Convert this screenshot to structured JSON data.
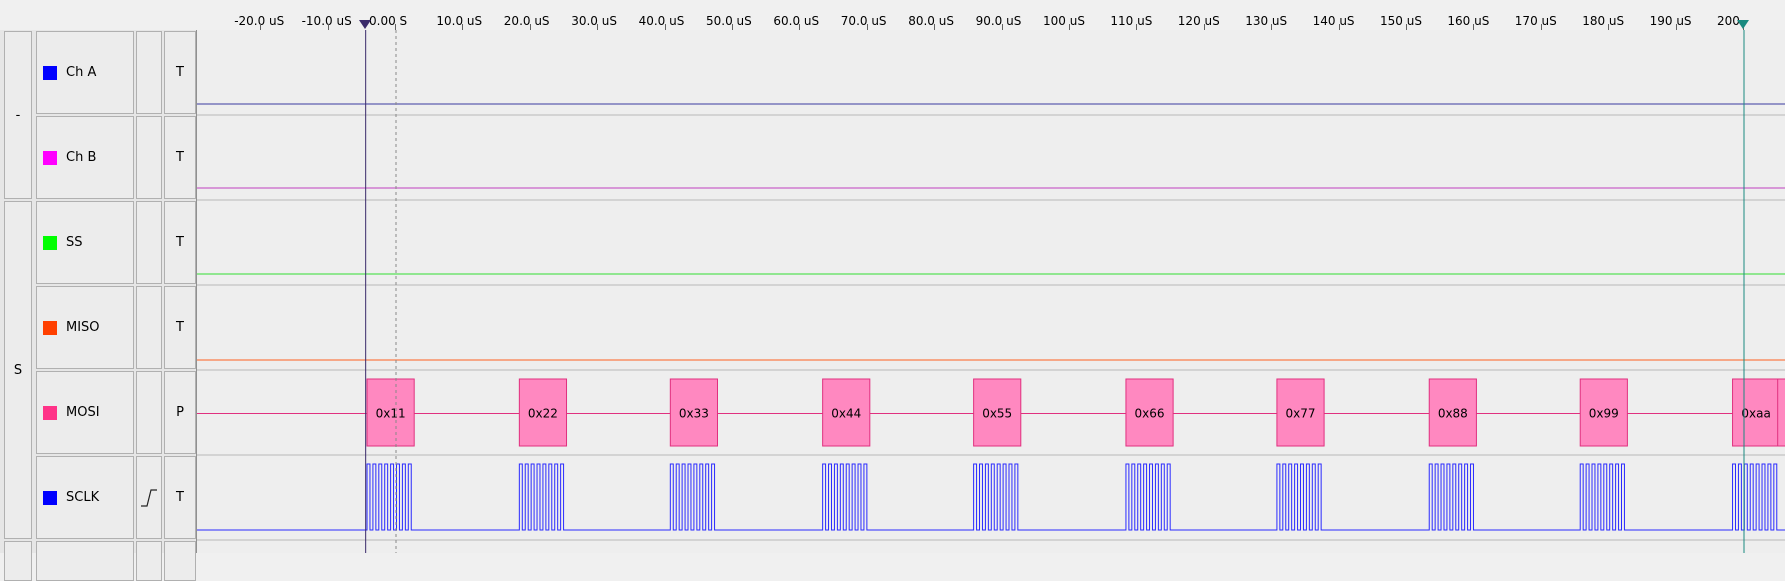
{
  "ruler": {
    "ticks": [
      {
        "label": "-20.0 uS",
        "t": -20
      },
      {
        "label": "-10.0 uS",
        "t": -10
      },
      {
        "label": "0.00  S",
        "t": 0
      },
      {
        "label": "10.0 uS",
        "t": 10
      },
      {
        "label": "20.0 uS",
        "t": 20
      },
      {
        "label": "30.0 uS",
        "t": 30
      },
      {
        "label": "40.0 uS",
        "t": 40
      },
      {
        "label": "50.0 uS",
        "t": 50
      },
      {
        "label": "60.0 uS",
        "t": 60
      },
      {
        "label": "70.0 uS",
        "t": 70
      },
      {
        "label": "80.0 uS",
        "t": 80
      },
      {
        "label": "90.0 uS",
        "t": 90
      },
      {
        "label": "100 uS",
        "t": 100
      },
      {
        "label": "110 uS",
        "t": 110
      },
      {
        "label": "120 uS",
        "t": 120
      },
      {
        "label": "130 uS",
        "t": 130
      },
      {
        "label": "140 uS",
        "t": 140
      },
      {
        "label": "150 uS",
        "t": 150
      },
      {
        "label": "160 uS",
        "t": 160
      },
      {
        "label": "170 uS",
        "t": 170
      },
      {
        "label": "180 uS",
        "t": 180
      },
      {
        "label": "190 uS",
        "t": 190
      },
      {
        "label": "200",
        "t": 200
      }
    ],
    "cursor_a_us": -4.5,
    "cursor_b_us": 200
  },
  "groups": [
    {
      "label": "-",
      "channel_count": 2
    },
    {
      "label": "S",
      "channel_count": 4
    }
  ],
  "channels": [
    {
      "name": "Ch A",
      "color": "#0000ff",
      "mode": "T",
      "trigger": ""
    },
    {
      "name": "Ch B",
      "color": "#ff00ff",
      "mode": "T",
      "trigger": ""
    },
    {
      "name": "SS",
      "color": "#00ff00",
      "mode": "T",
      "trigger": ""
    },
    {
      "name": "MISO",
      "color": "#ff4000",
      "mode": "T",
      "trigger": ""
    },
    {
      "name": "MOSI",
      "color": "#ff3388",
      "mode": "P",
      "trigger": ""
    },
    {
      "name": "SCLK",
      "color": "#0000ff",
      "mode": "T",
      "trigger": "rising-edge-icon"
    }
  ],
  "trace_colors": {
    "ch_a": "#3a3aa0",
    "ch_b": "#c040c0",
    "ss": "#33dd33",
    "miso": "#ff6020",
    "mosi": "#e0307f",
    "mosi_box": "#ff88c0",
    "sclk": "#2a2aff"
  },
  "mosi_bytes": [
    {
      "label": "0x11",
      "start_us": -4.3
    },
    {
      "label": "0x22",
      "start_us": 18.3
    },
    {
      "label": "0x33",
      "start_us": 40.7
    },
    {
      "label": "0x44",
      "start_us": 63.3
    },
    {
      "label": "0x55",
      "start_us": 85.7
    },
    {
      "label": "0x66",
      "start_us": 108.3
    },
    {
      "label": "0x77",
      "start_us": 130.7
    },
    {
      "label": "0x88",
      "start_us": 153.3
    },
    {
      "label": "0x99",
      "start_us": 175.7
    },
    {
      "label": "0xaa",
      "start_us": 198.3
    }
  ]
}
